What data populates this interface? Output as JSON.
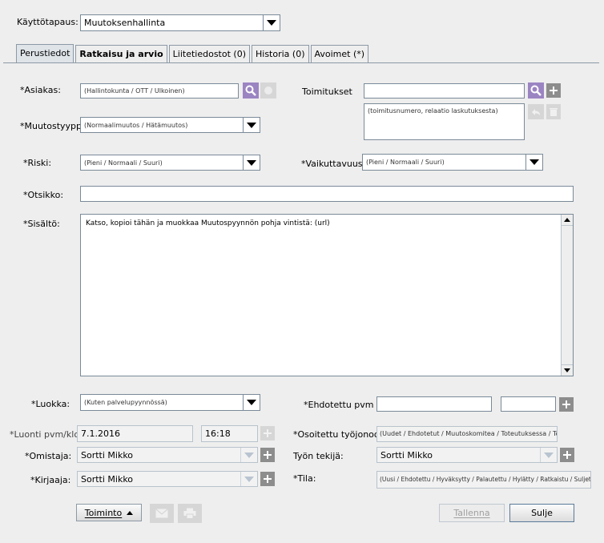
{
  "header": {
    "mode_label": "Käyttötapaus:",
    "mode_value": "Muutoksenhallinta"
  },
  "tabs": [
    "Perustiedot",
    "Ratkaisu ja arvio",
    "Liitetiedostot (0)",
    "Historia (0)",
    "Avoimet (*)"
  ],
  "form": {
    "asiakas": {
      "label": "*Asiakas:",
      "placeholder": "(Hallintokunta / OTT / Ulkoinen)"
    },
    "toimitukset": {
      "label": "Toimitukset",
      "placeholder": "(toimitusnumero, relaatio laskutuksesta)"
    },
    "muutostyyppi": {
      "label": "*Muutostyyppi:",
      "placeholder": "(Normaalimuutos / Hätämuutos)"
    },
    "riski": {
      "label": "*Riski:",
      "placeholder": "(Pieni / Normaali / Suuri)"
    },
    "vaikuttavuus": {
      "label": "*Vaikuttavuus:",
      "placeholder": "(Pieni / Normaali / Suuri)"
    },
    "otsikko": {
      "label": "*Otsikko:"
    },
    "sisalto": {
      "label": "*Sisältö:",
      "value": "Katso, kopioi tähän ja muokkaa Muutospyynnön pohja vintistä: (url)"
    },
    "luokka": {
      "label": "*Luokka:",
      "placeholder": "(Kuten palvelupyynnössä)"
    },
    "ehdotettu_pvm": {
      "label": "*Ehdotettu pvm"
    },
    "luonti": {
      "label": "*Luonti pvm/klo:",
      "date": "7.1.2016",
      "time": "16:18"
    },
    "osoitettu": {
      "label": "*Osoitettu työjonoon:",
      "placeholder": "(Uudet / Ehdotetut / Muutoskomitea / Toteutuksessa / Toteutetut)"
    },
    "omistaja": {
      "label": "*Omistaja:",
      "value": "Sortti Mikko"
    },
    "tyon_tekija": {
      "label": "Työn tekijä:",
      "value": "Sortti Mikko"
    },
    "kirjaaja": {
      "label": "*Kirjaaja:",
      "value": "Sortti Mikko"
    },
    "tila": {
      "label": "*Tila:",
      "placeholder": "(Uusi / Ehdotettu / Hyväksytty / Palautettu / Hylätty / Ratkaistu / Suljettu)"
    }
  },
  "footer": {
    "toiminto": "Toiminto",
    "tallenna": "Tallenna",
    "sulje": "Sulje"
  },
  "colors": {
    "accent": "#9b84c2",
    "icon_gray": "#8d8d8d",
    "background": "#eeeeee"
  }
}
